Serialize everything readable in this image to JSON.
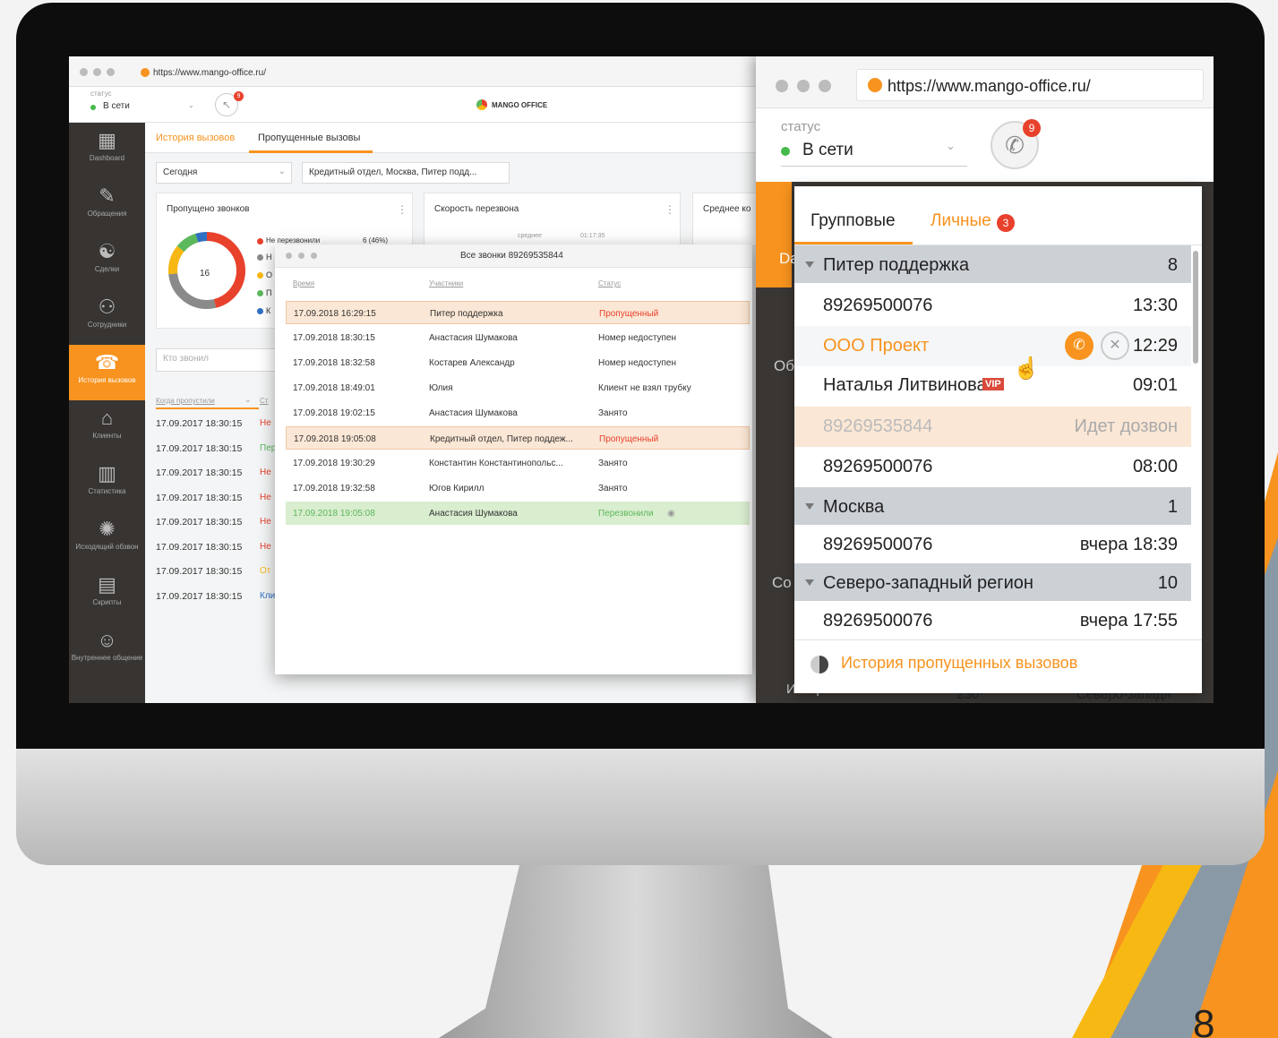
{
  "slide": {
    "page_number": "8"
  },
  "back_window": {
    "url": "https://www.mango-office.ru/",
    "status": {
      "label": "статус",
      "value": "В сети"
    },
    "missed_badge": "9",
    "logo": "MANGO OFFICE",
    "sidebar": [
      {
        "label": "Dashboard",
        "icon": "dashboard-icon"
      },
      {
        "label": "Обращения",
        "icon": "requests-icon"
      },
      {
        "label": "Сделки",
        "icon": "deals-icon"
      },
      {
        "label": "Сотрудники",
        "icon": "employees-icon"
      },
      {
        "label": "История вызовов",
        "icon": "call-history-icon"
      },
      {
        "label": "Клиенты",
        "icon": "clients-icon"
      },
      {
        "label": "Статистика",
        "icon": "statistics-icon"
      },
      {
        "label": "Исходящий обзвон",
        "icon": "outgoing-calls-icon"
      },
      {
        "label": "Скрипты",
        "icon": "scripts-icon"
      },
      {
        "label": "Внутреннее общение",
        "icon": "internal-chat-icon"
      }
    ],
    "tabs": [
      "История вызовов",
      "Пропущенные вызовы"
    ],
    "filters": {
      "period": "Сегодня",
      "groups": "Кредитный отдел, Москва, Питер подд..."
    },
    "cards": {
      "missed": {
        "title": "Пропущено звонков",
        "total": "16",
        "legend_first": "Не перезвонили",
        "legend_first_value": "6 (46%)",
        "legend": [
          "Н",
          "О",
          "П",
          "К"
        ]
      },
      "speed": {
        "title": "Скорость перезвона",
        "sub_label": "среднее",
        "sub_value": "01:17:35"
      },
      "avg": {
        "title": "Среднее ко"
      }
    },
    "search_placeholder": "Кто звонил",
    "list_header": [
      "Когда пропустили",
      "Ст"
    ],
    "list_rows": [
      {
        "time": "17.09.2017 18:30:15",
        "status": "Не"
      },
      {
        "time": "17.09.2017 18:30:15",
        "status": "Пер"
      },
      {
        "time": "17.09.2017 18:30:15",
        "status": "Не"
      },
      {
        "time": "17.09.2017 18:30:15",
        "status": "Не"
      },
      {
        "time": "17.09.2017 18:30:15",
        "status": "Не"
      },
      {
        "time": "17.09.2017 18:30:15",
        "status": "Не"
      },
      {
        "time": "17.09.2017 18:30:15",
        "status": "От"
      },
      {
        "time": "17.09.2017 18:30:15",
        "status": "Кли"
      }
    ]
  },
  "calls_modal": {
    "title": "Все звонки 89269535844",
    "columns": [
      "Время",
      "Участники",
      "Статус"
    ],
    "rows": [
      {
        "time": "17.09.2018 16:29:15",
        "who": "Питер поддержка",
        "status": "Пропущенный",
        "kind": "missed"
      },
      {
        "time": "17.09.2018 18:30:15",
        "who": "Анастасия Шумакова",
        "status": "Номер недоступен",
        "kind": "normal"
      },
      {
        "time": "17.09.2018 18:32:58",
        "who": "Костарев Александр",
        "status": "Номер недоступен",
        "kind": "normal"
      },
      {
        "time": "17.09.2018 18:49:01",
        "who": "Юлия",
        "status": "Клиент не взял трубку",
        "kind": "normal"
      },
      {
        "time": "17.09.2018 19:02:15",
        "who": "Анастасия Шумакова",
        "status": "Занято",
        "kind": "normal"
      },
      {
        "time": "17.09.2018 19:05:08",
        "who": "Кредитный отдел, Питер поддеж...",
        "status": "Пропущенный",
        "kind": "missed"
      },
      {
        "time": "17.09.2018 19:30:29",
        "who": "Константин Константинопольс...",
        "status": "Занято",
        "kind": "normal"
      },
      {
        "time": "17.09.2018 19:32:58",
        "who": "Югов Кирилл",
        "status": "Занято",
        "kind": "normal"
      },
      {
        "time": "17.09.2018 19:05:08",
        "who": "Анастасия Шумакова",
        "status": "Перезвонили",
        "kind": "called_back"
      }
    ]
  },
  "front_window": {
    "url": "https://www.mango-office.ru/",
    "status": {
      "label": "статус",
      "value": "В сети"
    },
    "missed_badge": "9",
    "background_fragments": [
      "Da",
      "Об",
      "Co",
      "Истори",
      "230",
      "Северо-западн",
      "y"
    ],
    "popup": {
      "tabs": [
        {
          "label": "Групповые"
        },
        {
          "label": "Личные",
          "badge": "3"
        }
      ],
      "rows": [
        {
          "type": "group",
          "name": "Питер поддержка",
          "count": "8"
        },
        {
          "type": "call",
          "name": "89269500076",
          "time": "13:30"
        },
        {
          "type": "call",
          "name": "ООО Проект",
          "time": "12:29",
          "actions": true
        },
        {
          "type": "call",
          "name": "Наталья Литвинова",
          "vip": "VIP",
          "time": "09:01"
        },
        {
          "type": "dialing",
          "name": "89269535844",
          "time": "Идет дозвон"
        },
        {
          "type": "call",
          "name": "89269500076",
          "time": "08:00"
        },
        {
          "type": "group",
          "name": "Москва",
          "count": "1"
        },
        {
          "type": "call",
          "name": "89269500076",
          "time": "вчера 18:39"
        },
        {
          "type": "group",
          "name": "Северо-западный регион",
          "count": "10"
        },
        {
          "type": "call",
          "name": "89269500076",
          "time": "вчера 17:55"
        }
      ],
      "footer_link": "История пропущенных вызовов"
    }
  },
  "colors": {
    "orange": "#f7931e",
    "missed_red": "#e8412c",
    "called_back_green": "#5cb85c",
    "bezel": "#0d0d0d",
    "sidebar_dark": "#373432",
    "group_row": "#ccd1d6"
  }
}
